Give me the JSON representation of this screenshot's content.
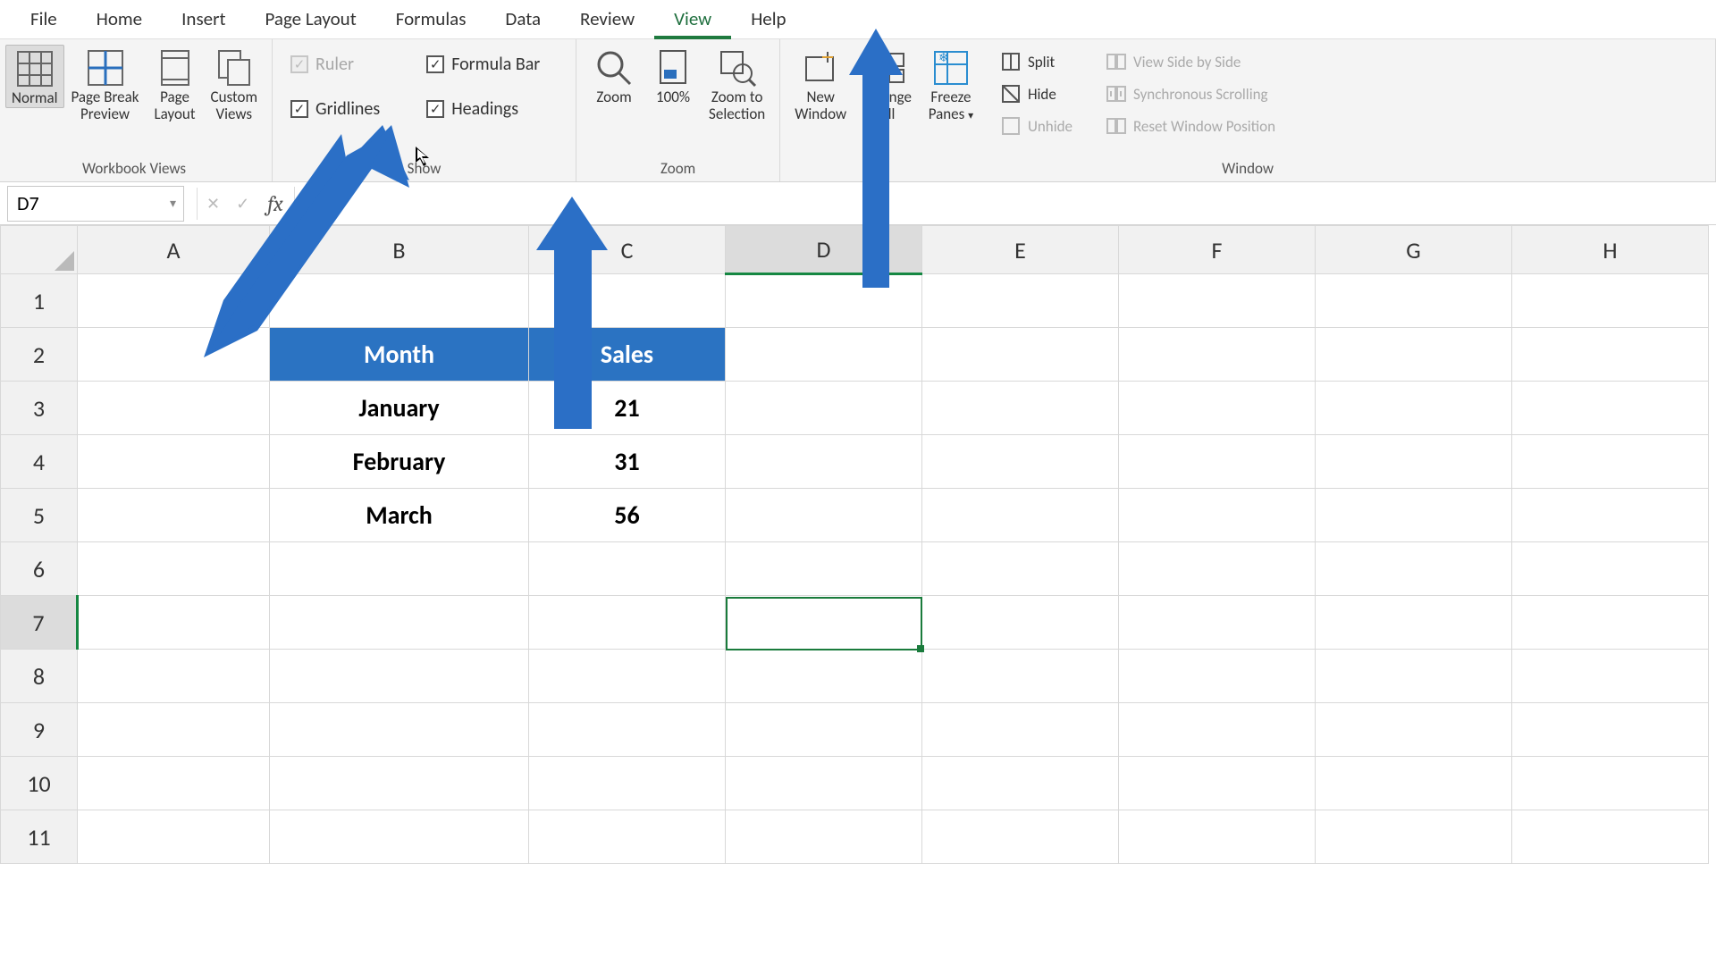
{
  "tabs": {
    "file": "File",
    "home": "Home",
    "insert": "Insert",
    "page_layout": "Page Layout",
    "formulas": "Formulas",
    "data": "Data",
    "review": "Review",
    "view": "View",
    "help": "Help",
    "active": "view"
  },
  "ribbon": {
    "workbook_views": {
      "label": "Workbook Views",
      "normal": "Normal",
      "page_break": "Page Break\nPreview",
      "page_layout": "Page\nLayout",
      "custom_views": "Custom\nViews"
    },
    "show": {
      "label": "Show",
      "ruler": {
        "label": "Ruler",
        "checked": true,
        "enabled": false
      },
      "formula_bar": {
        "label": "Formula Bar",
        "checked": true,
        "enabled": true
      },
      "gridlines": {
        "label": "Gridlines",
        "checked": true,
        "enabled": true
      },
      "headings": {
        "label": "Headings",
        "checked": true,
        "enabled": true
      }
    },
    "zoom_group": {
      "label": "Zoom",
      "zoom": "Zoom",
      "hundred": "100%",
      "to_selection": "Zoom to\nSelection"
    },
    "window": {
      "label": "Window",
      "new_window": "New\nWindow",
      "arrange_all": "Arrange\nAll",
      "freeze": "Freeze\nPanes",
      "split": "Split",
      "hide": "Hide",
      "unhide": "Unhide",
      "side_by_side": "View Side by Side",
      "sync_scroll": "Synchronous Scrolling",
      "reset_pos": "Reset Window Position"
    }
  },
  "formula_bar": {
    "name_box": "D7",
    "fx": "fx",
    "value": ""
  },
  "grid": {
    "col_headers": [
      "A",
      "B",
      "C",
      "D",
      "E",
      "F",
      "G",
      "H"
    ],
    "row_headers": [
      "1",
      "2",
      "3",
      "4",
      "5",
      "6",
      "7",
      "8",
      "9",
      "10",
      "11"
    ],
    "active_cell": "D7",
    "table": {
      "header": {
        "b": "Month",
        "c": "Sales"
      },
      "rows": [
        {
          "b": "January",
          "c": "21"
        },
        {
          "b": "February",
          "c": "31"
        },
        {
          "b": "March",
          "c": "56"
        }
      ]
    }
  }
}
